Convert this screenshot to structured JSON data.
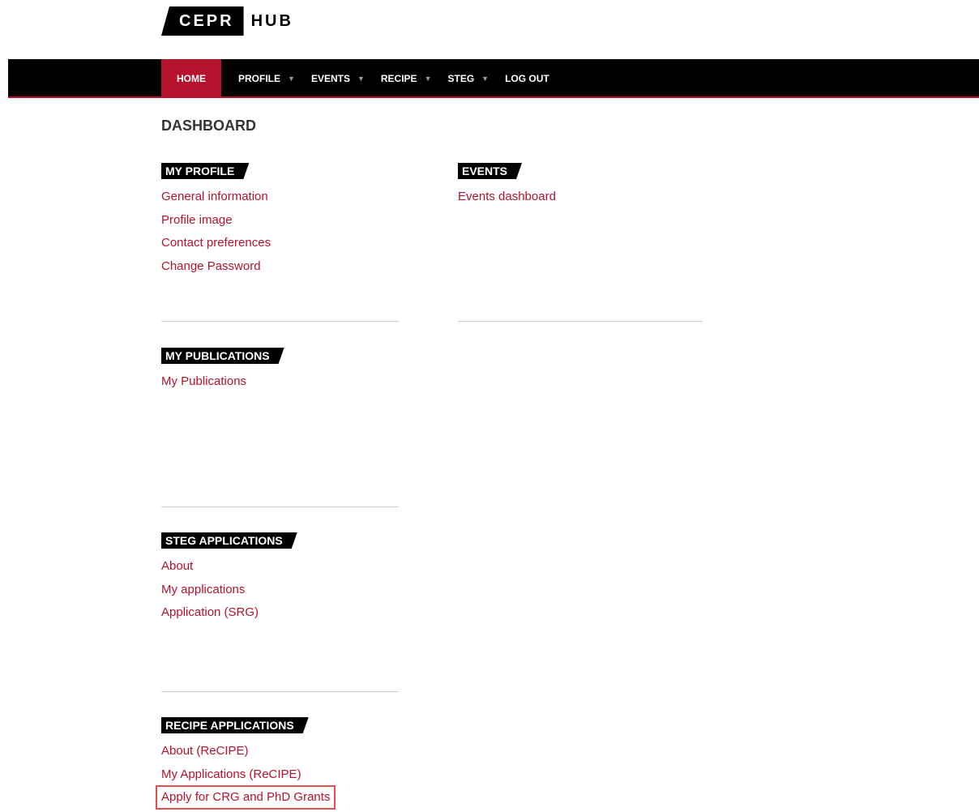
{
  "logo": {
    "box_text": "CEPR",
    "text": "HUB"
  },
  "nav": {
    "items": [
      {
        "label": "HOME",
        "active": true,
        "dropdown": false
      },
      {
        "label": "PROFILE",
        "active": false,
        "dropdown": true
      },
      {
        "label": "EVENTS",
        "active": false,
        "dropdown": true
      },
      {
        "label": "RECIPE",
        "active": false,
        "dropdown": true
      },
      {
        "label": "STEG",
        "active": false,
        "dropdown": true
      },
      {
        "label": "LOG OUT",
        "active": false,
        "dropdown": false
      }
    ],
    "caret": "▼"
  },
  "page": {
    "title": "DASHBOARD"
  },
  "sections": {
    "my_profile": {
      "heading": "MY PROFILE",
      "links": [
        "General information",
        "Profile image",
        "Contact preferences",
        "Change Password"
      ]
    },
    "events": {
      "heading": "EVENTS",
      "links": [
        "Events dashboard"
      ]
    },
    "my_publications": {
      "heading": "MY PUBLICATIONS",
      "links": [
        "My Publications"
      ]
    },
    "steg_applications": {
      "heading": "STEG APPLICATIONS",
      "links": [
        "About",
        "My applications",
        "Application (SRG)"
      ]
    },
    "recipe_applications": {
      "heading": "RECIPE APPLICATIONS",
      "links": [
        "About (ReCIPE)",
        "My Applications (ReCIPE)",
        "Apply for CRG and PhD Grants"
      ]
    }
  },
  "colors": {
    "accent": "#b5122e",
    "nav_bg": "#000000",
    "highlight_border": "#e34e4e"
  }
}
